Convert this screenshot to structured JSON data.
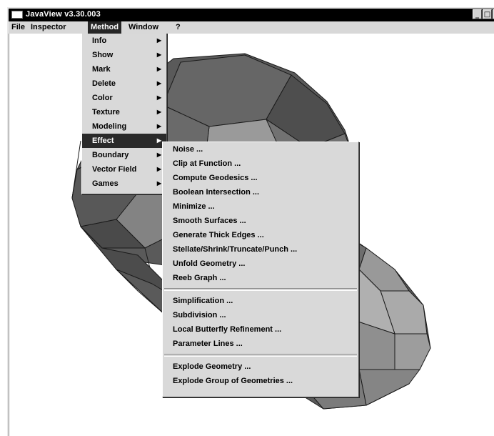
{
  "window": {
    "title": "JavaView v3.30.003",
    "minimize": "_",
    "maximize": "□",
    "close": "×"
  },
  "menubar": [
    "File",
    "Inspector",
    "Method",
    "Window",
    "?"
  ],
  "method_menu": {
    "items": [
      "Info",
      "Show",
      "Mark",
      "Delete",
      "Color",
      "Texture",
      "Modeling",
      "Effect",
      "Boundary",
      "Vector Field",
      "Games"
    ],
    "selected": "Effect",
    "arrow": "▶"
  },
  "effect_menu": {
    "groups": [
      [
        "Noise ...",
        "Clip at Function ...",
        "Compute Geodesics ...",
        "Boolean Intersection ...",
        "Minimize ...",
        "Smooth Surfaces ...",
        "Generate Thick Edges ...",
        "Stellate/Shrink/Truncate/Punch ...",
        "Unfold Geometry ...",
        "Reeb Graph ..."
      ],
      [
        "Simplification ...",
        "Subdivision ...",
        "Local Butterfly Refinement ...",
        "Parameter Lines ..."
      ],
      [
        "Explode Geometry ...",
        "Explode Group of Geometries ..."
      ]
    ]
  },
  "colors": {
    "menu_bg": "#d9d9d9",
    "highlight": "#2a2a2a",
    "surface_dark": "#555555",
    "surface_light": "#8a8a8a"
  }
}
